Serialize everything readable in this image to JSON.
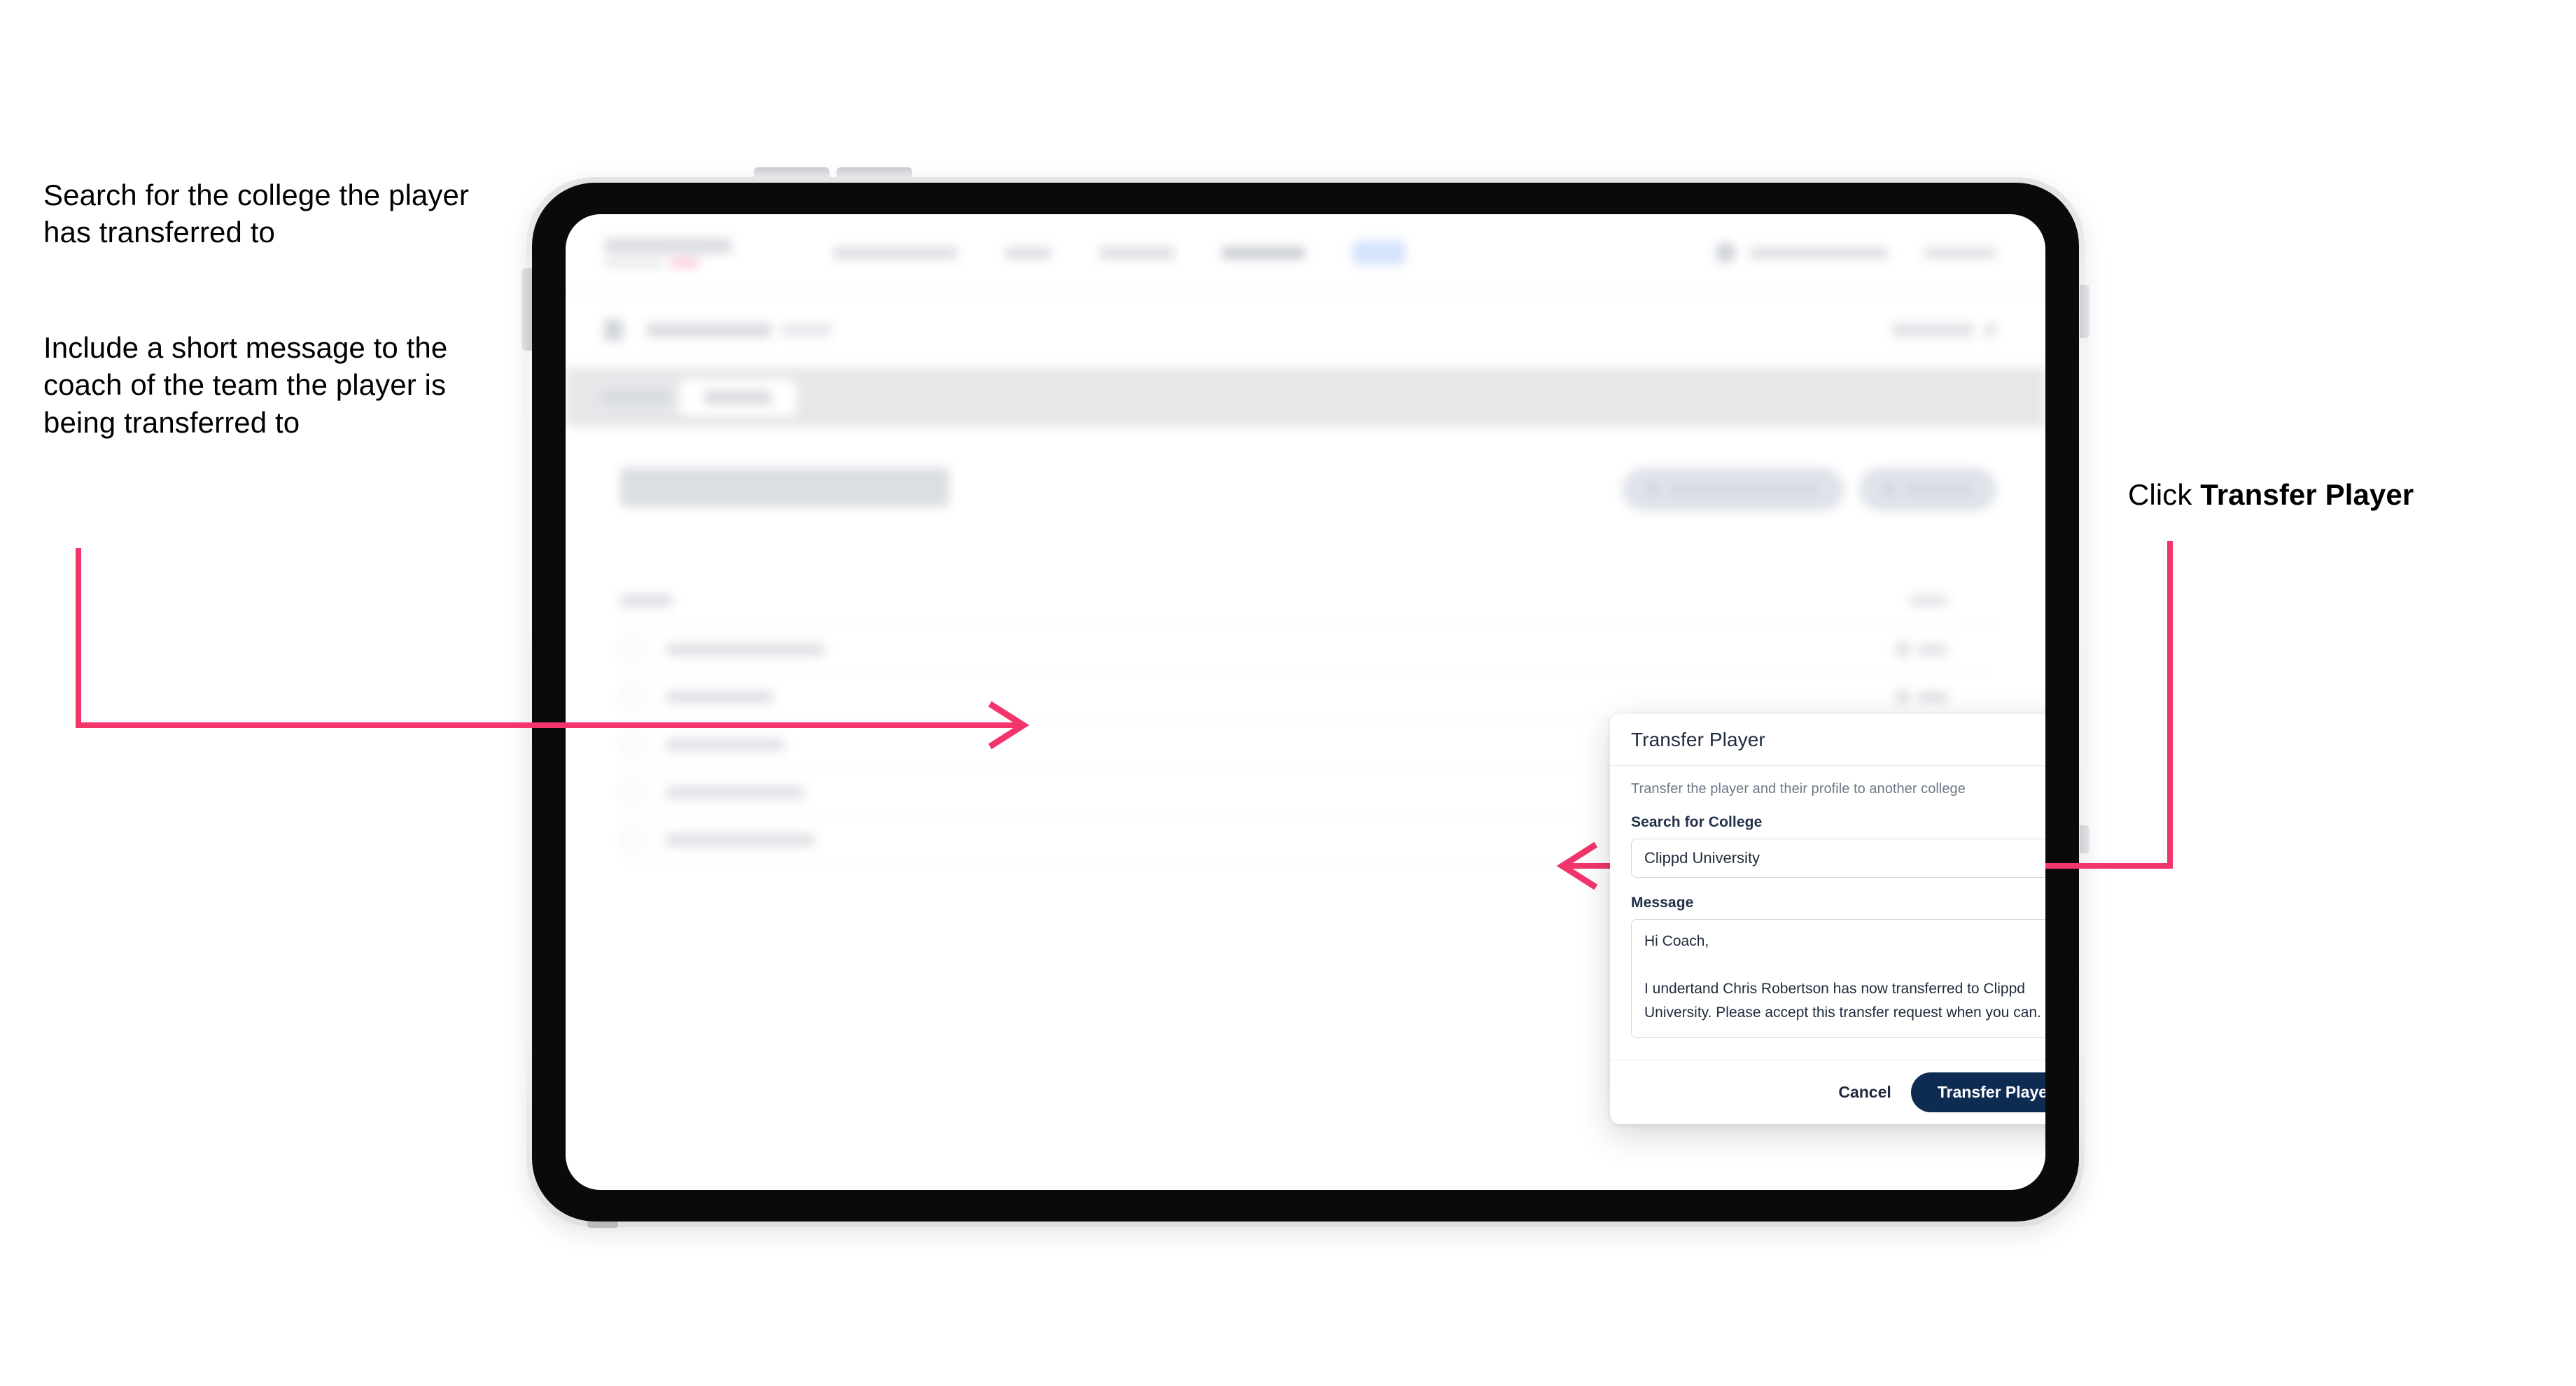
{
  "annotations": {
    "left_top": "Search for the college the player has transferred to",
    "left_bottom": "Include a short message to the coach of the team the player is being transferred to",
    "right_prefix": "Click ",
    "right_bold": "Transfer Player"
  },
  "colors": {
    "accent_pink": "#F2356B",
    "primary_navy": "#0E2B52",
    "text_dark": "#1F2A3C",
    "text_muted": "#6D7888",
    "border": "#D3D9E1"
  },
  "modal": {
    "title": "Transfer Player",
    "close_icon": "close-icon",
    "subtitle": "Transfer the player and their profile to another college",
    "college_label": "Search for College",
    "college_value": "Clippd University",
    "college_placeholder": "Search for College",
    "message_label": "Message",
    "message_value": "Hi Coach,\n\nI undertand Chris Robertson has now transferred to Clippd University. Please accept this transfer request when you can.",
    "message_placeholder": "Message",
    "cancel_label": "Cancel",
    "submit_label": "Transfer Player"
  },
  "background_app": {
    "page_title": "Update Roster",
    "note": "background page is blurred behind the modal"
  }
}
